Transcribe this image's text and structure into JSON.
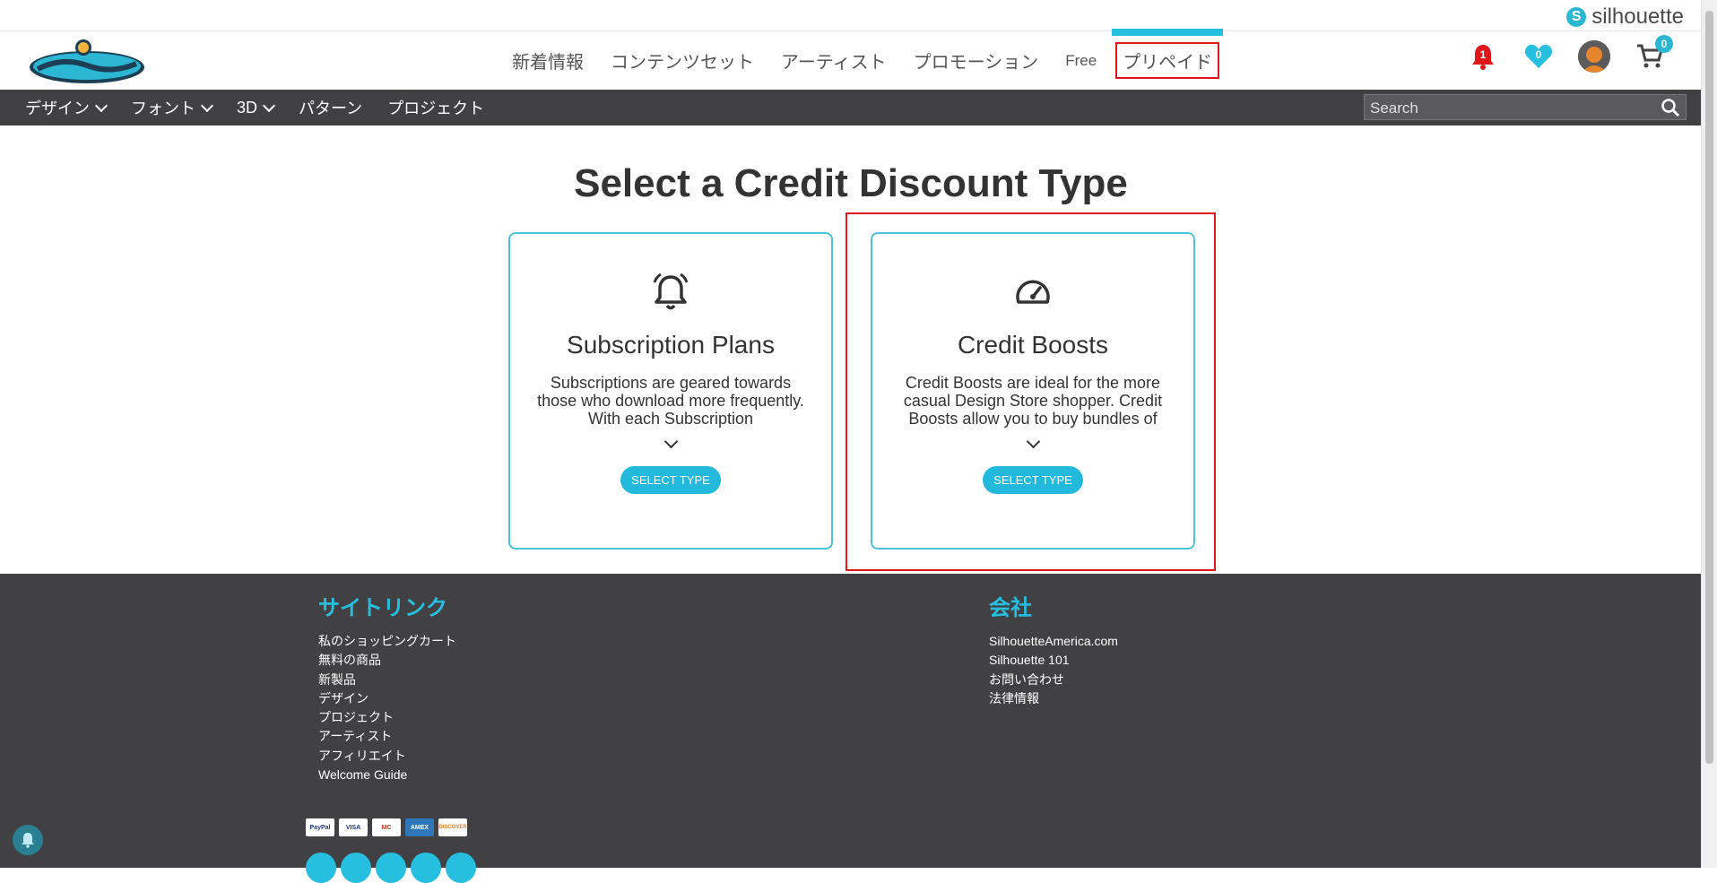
{
  "brand": {
    "silhouette_label": "silhouette"
  },
  "header": {
    "logo_alt": "the Design Store",
    "nav": [
      "新着情報",
      "コンテンツセット",
      "アーティスト",
      "プロモーション",
      "Free",
      "プリペイド"
    ],
    "active_nav": "プリペイド",
    "notifications_count": "1",
    "favorites_count": "0",
    "cart_count": "0"
  },
  "subnav": {
    "items": [
      {
        "label": "デザイン",
        "has_dropdown": true
      },
      {
        "label": "フォント",
        "has_dropdown": true
      },
      {
        "label": "3D",
        "has_dropdown": true
      },
      {
        "label": "パターン",
        "has_dropdown": false
      },
      {
        "label": "プロジェクト",
        "has_dropdown": false
      }
    ],
    "search_placeholder": "Search"
  },
  "main": {
    "title": "Select a Credit Discount Type",
    "cards": [
      {
        "icon": "bell-icon",
        "title": "Subscription Plans",
        "description": "Subscriptions are geared towards those who download more frequently. With each Subscription",
        "button": "SELECT TYPE"
      },
      {
        "icon": "speedometer-icon",
        "title": "Credit Boosts",
        "description": "Credit Boosts are ideal for the more casual Design Store shopper. Credit Boosts allow you to buy bundles of",
        "button": "SELECT TYPE"
      }
    ]
  },
  "footer": {
    "sitelinks_title": "サイトリンク",
    "sitelinks": [
      "私のショッピングカート",
      "無料の商品",
      "新製品",
      "デザイン",
      "プロジェクト",
      "アーティスト",
      "アフィリエイト",
      "Welcome Guide"
    ],
    "company_title": "会社",
    "company_links": [
      "SilhouetteAmerica.com",
      "Silhouette 101",
      "お問い合わせ",
      "法律情報"
    ],
    "payments": [
      "PayPal",
      "VISA",
      "MC",
      "AMEX",
      "DISCOVER"
    ],
    "socials": [
      "facebook-icon",
      "twitter-icon",
      "pinterest-icon",
      "instagram-icon",
      "youtube-icon"
    ]
  },
  "colors": {
    "accent": "#27bfe0",
    "dark": "#414042",
    "highlight": "#e0161b",
    "notification": "#e0161b"
  }
}
